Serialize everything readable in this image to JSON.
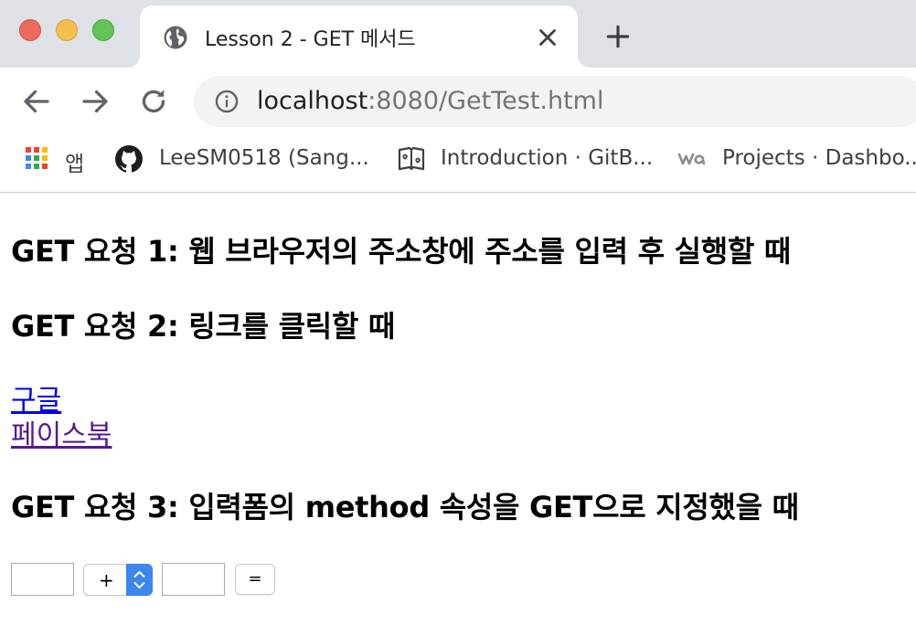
{
  "browser": {
    "tab": {
      "title": "Lesson 2 - GET 메서드"
    },
    "url": {
      "host": "localhost",
      "rest": ":8080/GetTest.html"
    },
    "bookmarks": [
      {
        "label": "앱",
        "icon": "apps-grid-icon"
      },
      {
        "label": "LeeSM0518 (Sang...",
        "icon": "github-icon"
      },
      {
        "label": "Introduction · GitB...",
        "icon": "gitbook-icon"
      },
      {
        "label": "Projects · Dashbo...",
        "icon": "wa-logo-icon"
      }
    ],
    "colors": {
      "tabstrip": "#dee1e6",
      "omnibox": "#f1f3f4",
      "accent": "#3b87f0"
    }
  },
  "page": {
    "heading1": "GET 요청 1: 웹 브라우저의 주소창에 주소를 입력 후 실행할 때",
    "heading2": "GET 요청 2: 링크를 클릭할 때",
    "links": {
      "google": "구글",
      "facebook": "페이스북"
    },
    "heading3": "GET 요청 3: 입력폼의 method 속성을 GET으로 지정했을 때",
    "form": {
      "operand1_value": "",
      "operator_selected": "+",
      "operand2_value": "",
      "submit_label": "="
    },
    "colors": {
      "link": "#0000ee",
      "visited_link": "#551a8b"
    }
  }
}
